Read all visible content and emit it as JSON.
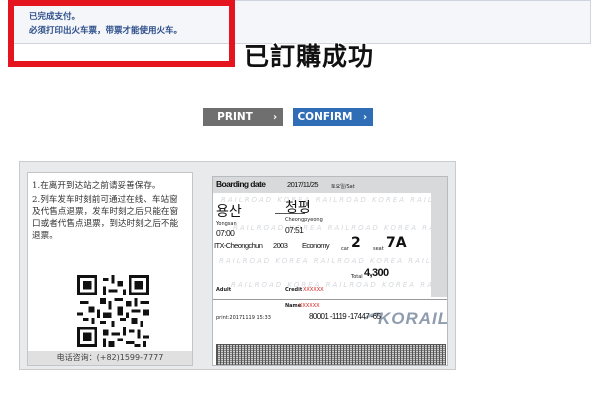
{
  "notice": {
    "line1": "已完成支付。",
    "line2": "必须打印出火车票，带票才能使用火车。"
  },
  "overlay_caption": "已訂購成功",
  "buttons": {
    "print": "PRINT",
    "confirm": "CONFIRM",
    "chevron": "›"
  },
  "ticket": {
    "left": {
      "instruction_lines": [
        "1.在离开到达站之前请妥善保存。",
        "2.列车发车时刻前可通过在线、车站窗",
        "及代售点退票，发车时刻之后只能在窗",
        "口或者代售点退票，到达时刻之后不能",
        "退票。"
      ],
      "phone": "电话咨询：(+82)1599-7777"
    },
    "boarding": {
      "header_label": "Boarding date",
      "date": "2017/11/25",
      "day": "토요일/Sat",
      "watermark": "RAILROAD KOREA RAILROAD KOREA RAILROAD",
      "from_kr": "용산",
      "from_en": "Yongsan",
      "from_time": "07:00",
      "to_kr": "청평",
      "to_en": "Cheongpyeong",
      "to_time": "07:51",
      "train_name": "ITX-Cheongchun",
      "train_no": "2003",
      "class": "Economy",
      "car_label": "car",
      "car": "2",
      "seat_label": "seat",
      "seat": "7A",
      "total_label": "Total",
      "total": "4,300",
      "passenger": "Adult",
      "credit_label": "Credit",
      "credit_value": "XXXXXX",
      "name_label": "Name",
      "name_value": "XXXXXX",
      "print_info": "print:20171119 15:33",
      "ticket_number": "80001 -1119 -17447 -65",
      "logo": "KORAIL"
    }
  },
  "colors": {
    "highlight": "#e4151f",
    "notice_text": "#2b4d8a",
    "print_button": "#6f6f6f",
    "confirm_button": "#2f6db7",
    "credit_text": "#d41a1a"
  }
}
